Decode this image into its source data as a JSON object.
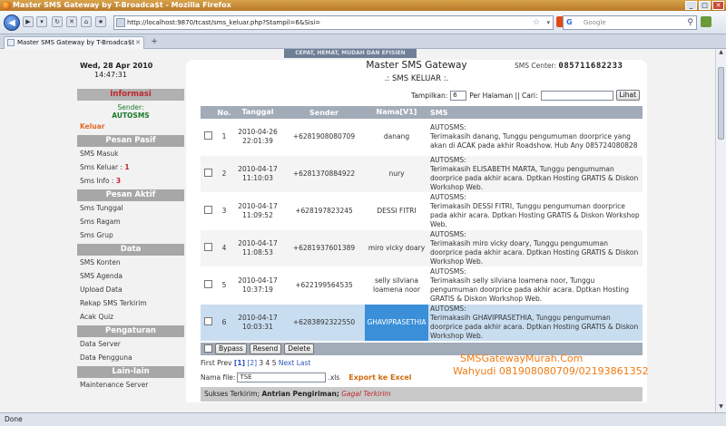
{
  "window": {
    "title": "Master SMS Gateway by T-Broadca$t - Mozilla Firefox"
  },
  "browser": {
    "url": "http://localhost:9870/tcast/sms_keluar.php?Stampil=6&Sisi=",
    "search_placeholder": "Google",
    "tab_title": "Master SMS Gateway by T-Broadca$t",
    "banner_text": "CEPAT, HEMAT, MUDAH DAN EFISIEN",
    "status": "Done"
  },
  "header": {
    "date": "Wed, 28 Apr 2010",
    "time": "14:47:31",
    "app_title": "Master SMS Gateway",
    "sms_center_label": "SMS Center:",
    "sms_center_number": "085711682233",
    "page_subtitle": ".: SMS KELUAR :."
  },
  "sidebar": {
    "info_title": "Informasi",
    "sender_label": "Sender:",
    "sender_value": "AUTOSMS",
    "active_item": "Keluar",
    "sections": [
      {
        "title": "Pesan Pasif",
        "items": [
          {
            "label": "SMS Masuk",
            "count": ""
          },
          {
            "label": "Sms Keluar : ",
            "count": "1"
          },
          {
            "label": "Sms Info : ",
            "count": "3"
          }
        ]
      },
      {
        "title": "Pesan Aktif",
        "items": [
          {
            "label": "Sms Tunggal",
            "count": ""
          },
          {
            "label": "Sms Ragam",
            "count": ""
          },
          {
            "label": "Sms Grup",
            "count": ""
          }
        ]
      },
      {
        "title": "Data",
        "items": [
          {
            "label": "SMS Konten",
            "count": ""
          },
          {
            "label": "SMS Agenda",
            "count": ""
          },
          {
            "label": "Upload Data",
            "count": ""
          },
          {
            "label": "Rekap SMS Terkirim",
            "count": ""
          },
          {
            "label": "Acak Quiz",
            "count": ""
          }
        ]
      },
      {
        "title": "Pengaturan",
        "items": [
          {
            "label": "Data Server",
            "count": ""
          },
          {
            "label": "Data Pengguna",
            "count": ""
          }
        ]
      },
      {
        "title": "Lain-lain",
        "items": [
          {
            "label": "Maintenance Server",
            "count": ""
          }
        ]
      }
    ]
  },
  "filter": {
    "show_label": "Tampilkan:",
    "show_value": "6",
    "per_page_label": "Per Halaman || Cari:",
    "search_value": "",
    "view_button": "Lihat"
  },
  "table": {
    "headers": [
      "No.",
      "Tanggal",
      "Sender",
      "Nama[V1]",
      "SMS"
    ],
    "rows": [
      {
        "no": "1",
        "date": "2010-04-26",
        "time": "22:01:39",
        "sender": "+6281908080709",
        "name": "danang",
        "sms_from": "AUTOSMS:",
        "sms": "Terimakasih danang, Tunggu pengumuman doorprice yang akan di ACAK pada akhir Roadshow. Hub Any 085724080828"
      },
      {
        "no": "2",
        "date": "2010-04-17",
        "time": "11:10:03",
        "sender": "+6281370884922",
        "name": "nury",
        "sms_from": "AUTOSMS:",
        "sms": "Terimakasih ELISABETH MARTA, Tunggu pengumuman doorprice pada akhir acara. Dptkan Hosting GRATIS & Diskon Workshop Web."
      },
      {
        "no": "3",
        "date": "2010-04-17",
        "time": "11:09:52",
        "sender": "+628197823245",
        "name": "DESSI FITRI",
        "sms_from": "AUTOSMS:",
        "sms": "Terimakasih DESSI FITRI, Tunggu pengumuman doorprice pada akhir acara. Dptkan Hosting GRATIS & Diskon Workshop Web."
      },
      {
        "no": "4",
        "date": "2010-04-17",
        "time": "11:08:53",
        "sender": "+6281937601389",
        "name": "miro vicky doary",
        "sms_from": "AUTOSMS:",
        "sms": "Terimakasih miro vicky doary, Tunggu pengumuman doorprice pada akhir acara. Dptkan Hosting GRATIS & Diskon Workshop Web."
      },
      {
        "no": "5",
        "date": "2010-04-17",
        "time": "10:37:19",
        "sender": "+622199564535",
        "name": "selly silviana loamena noor",
        "sms_from": "AUTOSMS:",
        "sms": "Terimakasih selly silviana loamena noor, Tunggu pengumuman doorprice pada akhir acara. Dptkan Hosting GRATIS & Diskon Workshop Web."
      },
      {
        "no": "6",
        "date": "2010-04-17",
        "time": "10:03:31",
        "sender": "+6283892322550",
        "name": "GHAVIPRASETHIA",
        "sms_from": "AUTOSMS:",
        "sms": "Terimakasih GHAVIPRASETHIA, Tunggu pengumuman doorprice pada akhir acara. Dptkan Hosting GRATIS & Diskon Workshop Web."
      }
    ]
  },
  "actions": {
    "bypass": "Bypass",
    "resend": "Resend",
    "delete": "Delete"
  },
  "pager": {
    "first_prev": "First Prev",
    "current": "[1]",
    "page2": "[2]",
    "rest": "3 4 5",
    "next_last": "Next Last"
  },
  "export": {
    "file_label": "Nama file:",
    "file_value": "TSE",
    "ext": ".xls",
    "button": "Export ke Excel"
  },
  "legend": {
    "success": "Sukses Terkirim;",
    "queue": "Antrian Pengiriman;",
    "failed": "Gagal Terkirim"
  },
  "watermark": {
    "line1": "SMSGatewayMurah.Com",
    "line2": "Wahyudi 081908080709/02193861352"
  },
  "colors": {
    "accent_orange": "#f07b12",
    "header_gray": "#a2abb8",
    "selected_row": "#c9ddf0",
    "highlight": "#3b8fd8",
    "alert_red": "#c1272d"
  }
}
